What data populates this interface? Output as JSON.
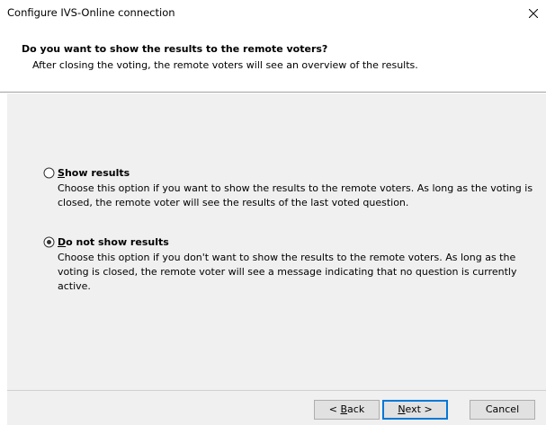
{
  "window": {
    "title": "Configure IVS-Online connection"
  },
  "header": {
    "title": "Do you want to show the results to the remote voters?",
    "subtitle": "After closing the voting, the remote voters will see an overview of the results."
  },
  "options": [
    {
      "mnemonic": "S",
      "label_rest": "how results",
      "description": "Choose this option if you want to show the results to the remote voters. As long as the voting is closed, the remote voter will see the results of the last voted question.",
      "selected": false
    },
    {
      "mnemonic": "D",
      "label_rest": "o not show results",
      "description": "Choose this option if you don't want to show the results to the remote voters. As long as the voting is closed, the remote voter will see a message indicating that no question is currently active.",
      "selected": true
    }
  ],
  "buttons": {
    "back": {
      "prefix": "< ",
      "mnemonic": "B",
      "rest": "ack"
    },
    "next": {
      "prefix": "",
      "mnemonic": "N",
      "rest": "ext >"
    },
    "cancel": "Cancel"
  },
  "icons": {
    "close": "close-icon",
    "radio_on": "radio-selected-icon",
    "radio_off": "radio-unselected-icon"
  },
  "colors": {
    "panel": "#f0f0f0",
    "default_button_border": "#0078d7",
    "radio_dot": "#333333"
  }
}
